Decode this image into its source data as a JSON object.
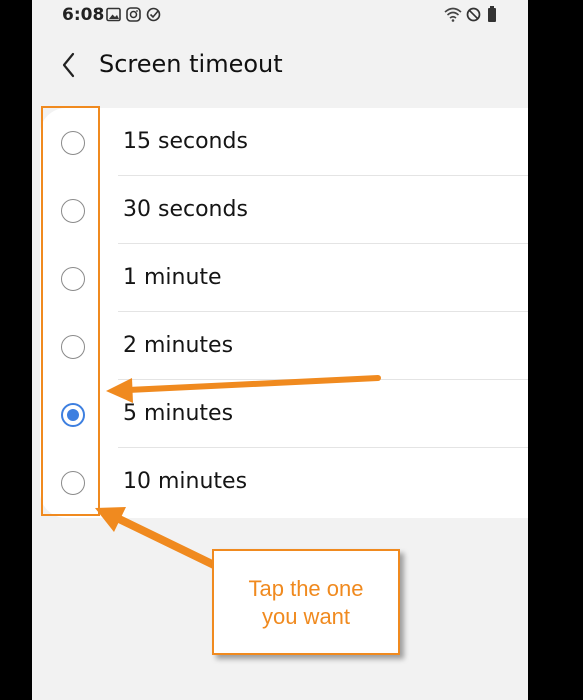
{
  "status_bar": {
    "time": "6:08",
    "left_icons": [
      "gallery-icon",
      "instagram-icon",
      "check-circle-icon"
    ],
    "right_icons": [
      "wifi-icon",
      "do-not-disturb-icon",
      "battery-icon"
    ]
  },
  "header": {
    "back_icon": "chevron-left-icon",
    "title": "Screen timeout"
  },
  "options": [
    {
      "label": "15 seconds",
      "selected": false
    },
    {
      "label": "30 seconds",
      "selected": false
    },
    {
      "label": "1 minute",
      "selected": false
    },
    {
      "label": "2 minutes",
      "selected": false
    },
    {
      "label": "5 minutes",
      "selected": true
    },
    {
      "label": "10 minutes",
      "selected": false
    }
  ],
  "annotation": {
    "callout_text": "Tap the one\nyou want",
    "color": "#f08a1f"
  },
  "colors": {
    "accent": "#3d7fe0",
    "background": "#f2f2f2",
    "card": "#ffffff"
  }
}
